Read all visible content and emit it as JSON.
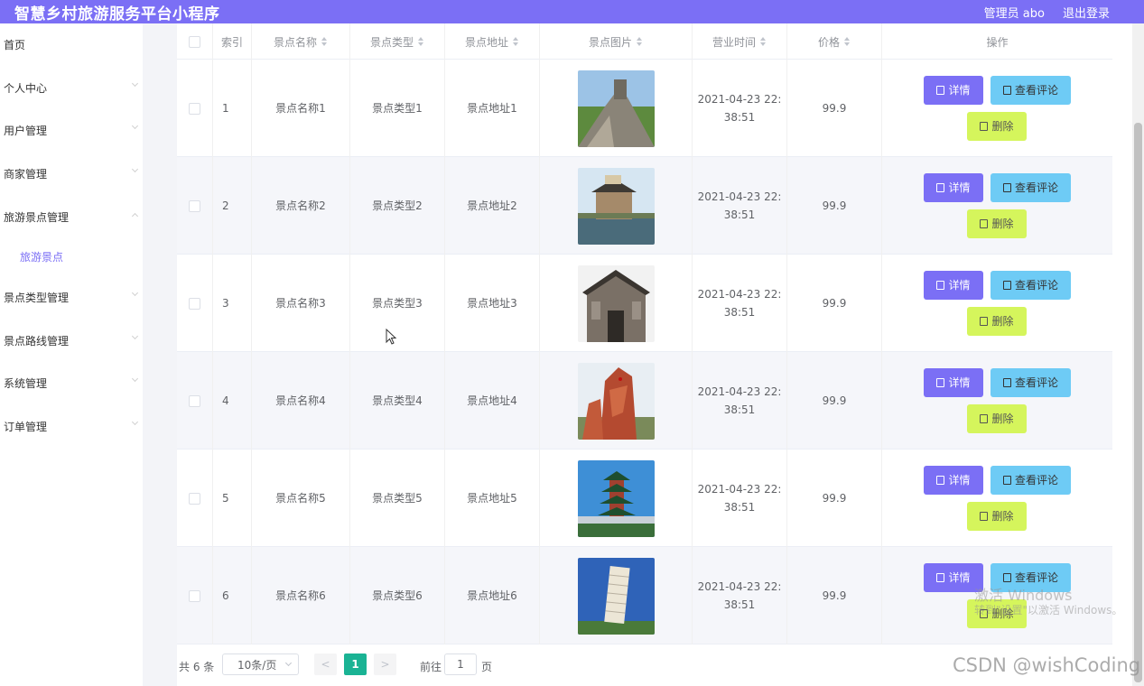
{
  "header": {
    "app_title": "智慧乡村旅游服务平台小程序",
    "user_label": "管理员 abo",
    "logout_label": "退出登录"
  },
  "sidebar": {
    "items": [
      {
        "label": "首页",
        "has_arrow": false
      },
      {
        "label": "个人中心",
        "has_arrow": true
      },
      {
        "label": "用户管理",
        "has_arrow": true
      },
      {
        "label": "商家管理",
        "has_arrow": true
      },
      {
        "label": "旅游景点管理",
        "has_arrow": true
      },
      {
        "label": "旅游景点",
        "sub": true,
        "active": true
      },
      {
        "label": "景点类型管理",
        "has_arrow": true
      },
      {
        "label": "景点路线管理",
        "has_arrow": true
      },
      {
        "label": "系统管理",
        "has_arrow": true
      },
      {
        "label": "订单管理",
        "has_arrow": true
      }
    ]
  },
  "table": {
    "columns": [
      "",
      "索引",
      "景点名称",
      "景点类型",
      "景点地址",
      "景点图片",
      "营业时间",
      "价格",
      "操作"
    ],
    "rows": [
      {
        "index": "1",
        "name": "景点名称1",
        "type": "景点类型1",
        "address": "景点地址1",
        "time_line1": "2021-04-23 22:",
        "time_line2": "38:51",
        "price": "99.9",
        "image": "great-wall-photo"
      },
      {
        "index": "2",
        "name": "景点名称2",
        "type": "景点类型2",
        "address": "景点地址2",
        "time_line1": "2021-04-23 22:",
        "time_line2": "38:51",
        "price": "99.9",
        "image": "tower-lake-photo"
      },
      {
        "index": "3",
        "name": "景点名称3",
        "type": "景点类型3",
        "address": "景点地址3",
        "time_line1": "2021-04-23 22:",
        "time_line2": "38:51",
        "price": "99.9",
        "image": "stone-gate-photo"
      },
      {
        "index": "4",
        "name": "景点名称4",
        "type": "景点类型4",
        "address": "景点地址4",
        "time_line1": "2021-04-23 22:",
        "time_line2": "38:51",
        "price": "99.9",
        "image": "red-rock-photo"
      },
      {
        "index": "5",
        "name": "景点名称5",
        "type": "景点类型5",
        "address": "景点地址5",
        "time_line1": "2021-04-23 22:",
        "time_line2": "38:51",
        "price": "99.9",
        "image": "pagoda-photo"
      },
      {
        "index": "6",
        "name": "景点名称6",
        "type": "景点类型6",
        "address": "景点地址6",
        "time_line1": "2021-04-23 22:",
        "time_line2": "38:51",
        "price": "99.9",
        "image": "leaning-tower-photo"
      }
    ],
    "actions": {
      "detail": "详情",
      "comment": "查看评论",
      "delete": "删除"
    }
  },
  "pagination": {
    "total_label": "共 6 条",
    "page_size": "10条/页",
    "prev": "<",
    "current_page": "1",
    "next": ">",
    "goto_label": "前往",
    "goto_value": "1",
    "goto_unit": "页"
  },
  "watermarks": {
    "activate_title": "激活 Windows",
    "activate_sub": "转到\"设置\"以激活 Windows。",
    "csdn": "CSDN @wishCoding"
  },
  "colors": {
    "accent": "#7b6ff5",
    "comment_button": "#6ecbf5",
    "delete_button": "#d5f55c",
    "page_active": "#1ab394"
  }
}
